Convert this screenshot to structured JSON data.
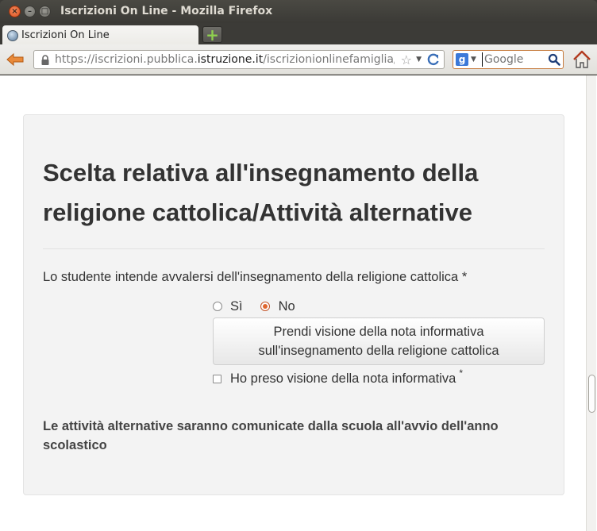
{
  "window": {
    "title": "Iscrizioni On Line - Mozilla Firefox"
  },
  "tabs": [
    {
      "label": "Iscrizioni On Line"
    }
  ],
  "navbar": {
    "url_prefix": "https://iscrizioni.pubblica.",
    "url_domain": "istruzione.it",
    "url_suffix": "/iscrizionionlinefamiglia/r",
    "search_placeholder": "Google"
  },
  "form": {
    "heading": "Scelta relativa all'insegnamento della religione cattolica/Attività alternative",
    "question": "Lo studente intende avvalersi dell'insegnamento della religione cattolica *",
    "options": [
      {
        "label": "Sì",
        "selected": false
      },
      {
        "label": "No",
        "selected": true
      }
    ],
    "info_button_line1": "Prendi visione della nota informativa",
    "info_button_line2": "sull'insegnamento della religione cattolica",
    "checkbox_label": "Ho preso visione della nota informativa",
    "checkbox_required_mark": "*",
    "note": "Le attività alternative saranno comunicate dalla scuola all'avvio dell'anno scolastico"
  },
  "colors": {
    "accent": "#e0662e",
    "panel_bg": "#f3f3f3",
    "text": "#333333"
  }
}
